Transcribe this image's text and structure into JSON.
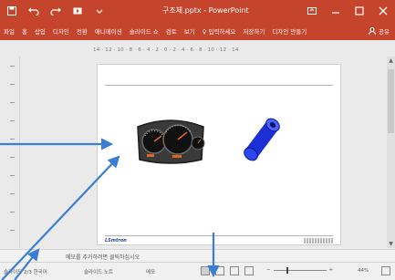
{
  "app": {
    "window_title": "구조체.pptx - PowerPoint"
  },
  "ribbon": {
    "tabs": [
      "파일",
      "홈",
      "삽입",
      "디자인",
      "전환",
      "애니메이션",
      "슬라이드 쇼",
      "검토",
      "보기",
      "♀ 입력하세요",
      "저장하기",
      "디자인 만들기"
    ],
    "share_label": "공유"
  },
  "ruler": {
    "label": "14 · 12 · 10 · 8 · 6 · 4 · 2 · 0 · 2 · 4 · 6 · 8 · 10 · 12 · 14"
  },
  "slide": {
    "logo_text": "LSmtron"
  },
  "notes": {
    "placeholder": "메모를 추가하려면 클릭하십시오"
  },
  "statusbar": {
    "slide_info": "슬라이드 2/3",
    "language": "한국어",
    "notes_label": "슬라이드 노트",
    "comments_label": "메모",
    "zoom_value": "44%"
  },
  "colors": {
    "titlebar": "#c4452c",
    "annotation_arrow": "#3b7fd4"
  }
}
